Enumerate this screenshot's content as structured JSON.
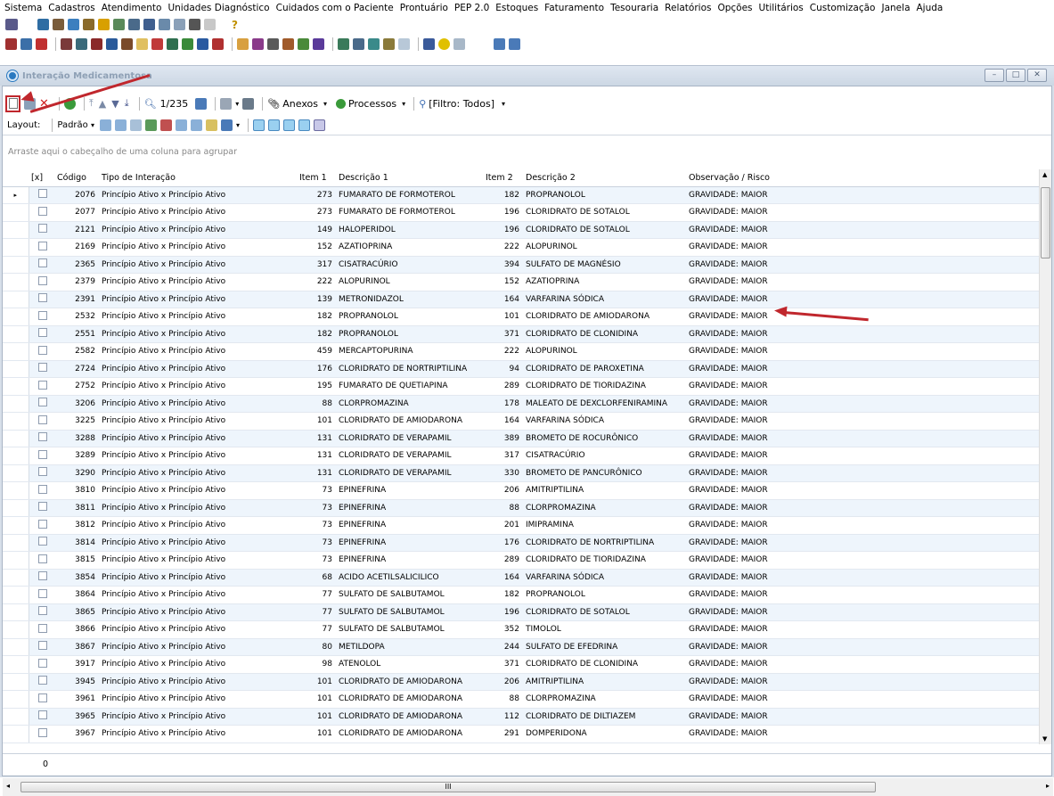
{
  "menu": [
    "Sistema",
    "Cadastros",
    "Atendimento",
    "Unidades Diagnóstico",
    "Cuidados com o Paciente",
    "Prontuário",
    "PEP 2.0",
    "Estoques",
    "Faturamento",
    "Tesouraria",
    "Relatórios",
    "Opções",
    "Utilitários",
    "Customização",
    "Janela",
    "Ajuda"
  ],
  "help_glyph": "?",
  "window": {
    "title": "Interação Medicamentosa",
    "min": "–",
    "max": "□",
    "close": "✕"
  },
  "toolbar": {
    "delete": "✕",
    "record_counter": "1/235",
    "attachments": "Anexos",
    "processes": "Processos",
    "filter": "[Filtro: Todos]"
  },
  "layout_bar": {
    "label": "Layout:",
    "preset": "Padrão"
  },
  "group_hint": "Arraste aqui o cabeçalho de uma coluna para agrupar",
  "columns": [
    "[x]",
    "Código",
    "Tipo de Interação",
    "Item 1",
    "Descrição 1",
    "Item 2",
    "Descrição 2",
    "Observação / Risco"
  ],
  "rows": [
    [
      "2076",
      "Princípio Ativo x Princípio Ativo",
      "273",
      "FUMARATO DE FORMOTEROL",
      "182",
      "PROPRANOLOL",
      "GRAVIDADE: MAIOR"
    ],
    [
      "2077",
      "Princípio Ativo x Princípio Ativo",
      "273",
      "FUMARATO DE FORMOTEROL",
      "196",
      "CLORIDRATO DE SOTALOL",
      "GRAVIDADE: MAIOR"
    ],
    [
      "2121",
      "Princípio Ativo x Princípio Ativo",
      "149",
      "HALOPERIDOL",
      "196",
      "CLORIDRATO DE SOTALOL",
      "GRAVIDADE: MAIOR"
    ],
    [
      "2169",
      "Princípio Ativo x Princípio Ativo",
      "152",
      "AZATIOPRINA",
      "222",
      "ALOPURINOL",
      "GRAVIDADE: MAIOR"
    ],
    [
      "2365",
      "Princípio Ativo x Princípio Ativo",
      "317",
      "CISATRACÚRIO",
      "394",
      "SULFATO DE MAGNÉSIO",
      "GRAVIDADE: MAIOR"
    ],
    [
      "2379",
      "Princípio Ativo x Princípio Ativo",
      "222",
      "ALOPURINOL",
      "152",
      "AZATIOPRINA",
      "GRAVIDADE: MAIOR"
    ],
    [
      "2391",
      "Princípio Ativo x Princípio Ativo",
      "139",
      "METRONIDAZOL",
      "164",
      "VARFARINA SÓDICA",
      "GRAVIDADE: MAIOR"
    ],
    [
      "2532",
      "Princípio Ativo x Princípio Ativo",
      "182",
      "PROPRANOLOL",
      "101",
      "CLORIDRATO DE AMIODARONA",
      "GRAVIDADE: MAIOR"
    ],
    [
      "2551",
      "Princípio Ativo x Princípio Ativo",
      "182",
      "PROPRANOLOL",
      "371",
      "CLORIDRATO DE CLONIDINA",
      "GRAVIDADE: MAIOR"
    ],
    [
      "2582",
      "Princípio Ativo x Princípio Ativo",
      "459",
      "MERCAPTOPURINA",
      "222",
      "ALOPURINOL",
      "GRAVIDADE: MAIOR"
    ],
    [
      "2724",
      "Princípio Ativo x Princípio Ativo",
      "176",
      "CLORIDRATO DE NORTRIPTILINA",
      "94",
      "CLORIDRATO DE PAROXETINA",
      "GRAVIDADE: MAIOR"
    ],
    [
      "2752",
      "Princípio Ativo x Princípio Ativo",
      "195",
      "FUMARATO DE QUETIAPINA",
      "289",
      "CLORIDRATO DE TIORIDAZINA",
      "GRAVIDADE: MAIOR"
    ],
    [
      "3206",
      "Princípio Ativo x Princípio Ativo",
      "88",
      "CLORPROMAZINA",
      "178",
      "MALEATO DE DEXCLORFENIRAMINA",
      "GRAVIDADE: MAIOR"
    ],
    [
      "3225",
      "Princípio Ativo x Princípio Ativo",
      "101",
      "CLORIDRATO DE AMIODARONA",
      "164",
      "VARFARINA SÓDICA",
      "GRAVIDADE: MAIOR"
    ],
    [
      "3288",
      "Princípio Ativo x Princípio Ativo",
      "131",
      "CLORIDRATO DE VERAPAMIL",
      "389",
      "BROMETO DE ROCURÔNICO",
      "GRAVIDADE: MAIOR"
    ],
    [
      "3289",
      "Princípio Ativo x Princípio Ativo",
      "131",
      "CLORIDRATO DE VERAPAMIL",
      "317",
      "CISATRACÚRIO",
      "GRAVIDADE: MAIOR"
    ],
    [
      "3290",
      "Princípio Ativo x Princípio Ativo",
      "131",
      "CLORIDRATO DE VERAPAMIL",
      "330",
      "BROMETO DE PANCURÔNICO",
      "GRAVIDADE: MAIOR"
    ],
    [
      "3810",
      "Princípio Ativo x Princípio Ativo",
      "73",
      "EPINEFRINA",
      "206",
      "AMITRIPTILINA",
      "GRAVIDADE: MAIOR"
    ],
    [
      "3811",
      "Princípio Ativo x Princípio Ativo",
      "73",
      "EPINEFRINA",
      "88",
      "CLORPROMAZINA",
      "GRAVIDADE: MAIOR"
    ],
    [
      "3812",
      "Princípio Ativo x Princípio Ativo",
      "73",
      "EPINEFRINA",
      "201",
      "IMIPRAMINA",
      "GRAVIDADE: MAIOR"
    ],
    [
      "3814",
      "Princípio Ativo x Princípio Ativo",
      "73",
      "EPINEFRINA",
      "176",
      "CLORIDRATO DE NORTRIPTILINA",
      "GRAVIDADE: MAIOR"
    ],
    [
      "3815",
      "Princípio Ativo x Princípio Ativo",
      "73",
      "EPINEFRINA",
      "289",
      "CLORIDRATO DE TIORIDAZINA",
      "GRAVIDADE: MAIOR"
    ],
    [
      "3854",
      "Princípio Ativo x Princípio Ativo",
      "68",
      "ACIDO ACETILSALICILICO",
      "164",
      "VARFARINA SÓDICA",
      "GRAVIDADE: MAIOR"
    ],
    [
      "3864",
      "Princípio Ativo x Princípio Ativo",
      "77",
      "SULFATO DE SALBUTAMOL",
      "182",
      "PROPRANOLOL",
      "GRAVIDADE: MAIOR"
    ],
    [
      "3865",
      "Princípio Ativo x Princípio Ativo",
      "77",
      "SULFATO DE SALBUTAMOL",
      "196",
      "CLORIDRATO DE SOTALOL",
      "GRAVIDADE: MAIOR"
    ],
    [
      "3866",
      "Princípio Ativo x Princípio Ativo",
      "77",
      "SULFATO DE SALBUTAMOL",
      "352",
      "TIMOLOL",
      "GRAVIDADE: MAIOR"
    ],
    [
      "3867",
      "Princípio Ativo x Princípio Ativo",
      "80",
      "METILDOPA",
      "244",
      "SULFATO DE EFEDRINA",
      "GRAVIDADE: MAIOR"
    ],
    [
      "3917",
      "Princípio Ativo x Princípio Ativo",
      "98",
      "ATENOLOL",
      "371",
      "CLORIDRATO DE CLONIDINA",
      "GRAVIDADE: MAIOR"
    ],
    [
      "3945",
      "Princípio Ativo x Princípio Ativo",
      "101",
      "CLORIDRATO DE AMIODARONA",
      "206",
      "AMITRIPTILINA",
      "GRAVIDADE: MAIOR"
    ],
    [
      "3961",
      "Princípio Ativo x Princípio Ativo",
      "101",
      "CLORIDRATO DE AMIODARONA",
      "88",
      "CLORPROMAZINA",
      "GRAVIDADE: MAIOR"
    ],
    [
      "3965",
      "Princípio Ativo x Princípio Ativo",
      "101",
      "CLORIDRATO DE AMIODARONA",
      "112",
      "CLORIDRATO DE DILTIAZEM",
      "GRAVIDADE: MAIOR"
    ],
    [
      "3967",
      "Princípio Ativo x Princípio Ativo",
      "101",
      "CLORIDRATO DE AMIODARONA",
      "291",
      "DOMPERIDONA",
      "GRAVIDADE: MAIOR"
    ]
  ],
  "footer_count": "0",
  "hscroll_grip": "III",
  "colors": {
    "arrow": "#c0272d",
    "row_alt": "#eef5fc",
    "titlebar": "#ccd7e4"
  }
}
